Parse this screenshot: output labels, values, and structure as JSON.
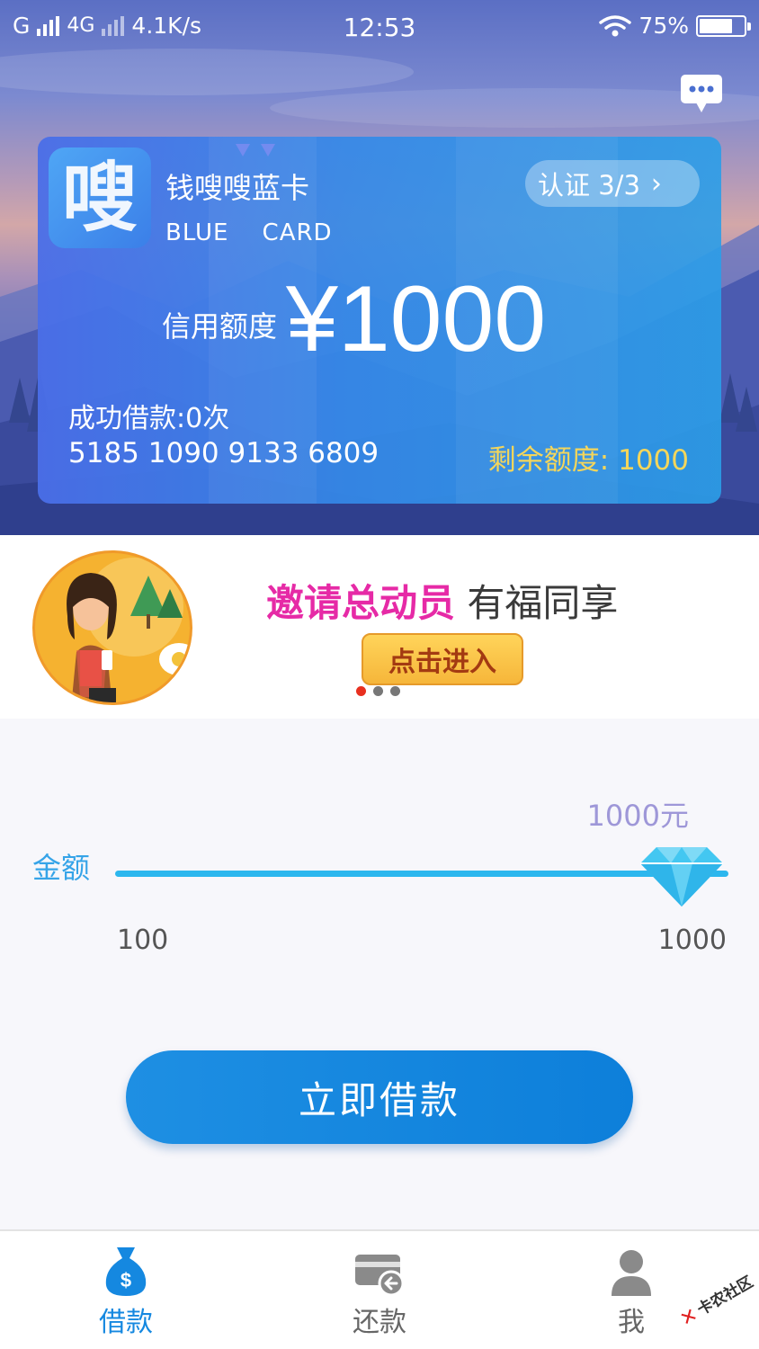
{
  "status_bar": {
    "carrier": "G",
    "network": "4G",
    "speed": "4.1K/s",
    "time": "12:53",
    "battery": "75%",
    "battery_level": 0.75
  },
  "card": {
    "logo_char": "嗖",
    "name": "钱嗖嗖蓝卡",
    "subtitle": "BLUE    CARD",
    "verify_label": "认证 3/3",
    "credit_label": "信用额度",
    "credit_amount": "¥1000",
    "loans_text": "成功借款:0次",
    "card_number": "5185 1090 9133 6809",
    "remaining_text": "剩余额度: 1000"
  },
  "banner": {
    "title_highlight": "邀请总动员",
    "title_rest": " 有福同享",
    "button_label": "点击进入",
    "dots_total": 3,
    "dots_active": 0
  },
  "amount": {
    "label": "金额",
    "current_value": "1000元",
    "min": "100",
    "max": "1000",
    "slider_value": 1000,
    "submit_label": "立即借款"
  },
  "tabbar": {
    "items": [
      {
        "label": "借款",
        "icon": "money-bag-icon",
        "active": true
      },
      {
        "label": "还款",
        "icon": "card-repay-icon",
        "active": false
      },
      {
        "label": "我",
        "icon": "user-icon",
        "active": false
      }
    ]
  },
  "colors": {
    "accent": "#1588e0",
    "slider": "#2cb7ee",
    "highlight_pink": "#e62aa6",
    "remaining_yellow": "#f4d65b"
  },
  "watermark": "卡农社区"
}
